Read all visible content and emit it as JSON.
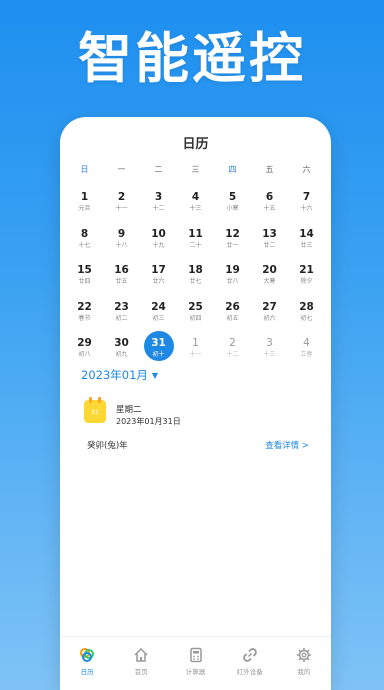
{
  "hero_title": "智能遥控",
  "screen_title": "日历",
  "weekdays": [
    "日",
    "一",
    "二",
    "三",
    "四",
    "五",
    "六"
  ],
  "days": [
    {
      "num": "1",
      "lunar": "元旦",
      "other": false
    },
    {
      "num": "2",
      "lunar": "十一",
      "other": false
    },
    {
      "num": "3",
      "lunar": "十二",
      "other": false
    },
    {
      "num": "4",
      "lunar": "十三",
      "other": false
    },
    {
      "num": "5",
      "lunar": "小寒",
      "other": false
    },
    {
      "num": "6",
      "lunar": "十五",
      "other": false
    },
    {
      "num": "7",
      "lunar": "十六",
      "other": false
    },
    {
      "num": "8",
      "lunar": "十七",
      "other": false
    },
    {
      "num": "9",
      "lunar": "十八",
      "other": false
    },
    {
      "num": "10",
      "lunar": "十九",
      "other": false
    },
    {
      "num": "11",
      "lunar": "二十",
      "other": false
    },
    {
      "num": "12",
      "lunar": "廿一",
      "other": false
    },
    {
      "num": "13",
      "lunar": "廿二",
      "other": false
    },
    {
      "num": "14",
      "lunar": "廿三",
      "other": false
    },
    {
      "num": "15",
      "lunar": "廿四",
      "other": false
    },
    {
      "num": "16",
      "lunar": "廿五",
      "other": false
    },
    {
      "num": "17",
      "lunar": "廿六",
      "other": false
    },
    {
      "num": "18",
      "lunar": "廿七",
      "other": false
    },
    {
      "num": "19",
      "lunar": "廿八",
      "other": false
    },
    {
      "num": "20",
      "lunar": "大寒",
      "other": false
    },
    {
      "num": "21",
      "lunar": "除夕",
      "other": false
    },
    {
      "num": "22",
      "lunar": "春节",
      "other": false
    },
    {
      "num": "23",
      "lunar": "初二",
      "other": false
    },
    {
      "num": "24",
      "lunar": "初三",
      "other": false
    },
    {
      "num": "25",
      "lunar": "初四",
      "other": false
    },
    {
      "num": "26",
      "lunar": "初五",
      "other": false
    },
    {
      "num": "27",
      "lunar": "初六",
      "other": false
    },
    {
      "num": "28",
      "lunar": "初七",
      "other": false
    },
    {
      "num": "29",
      "lunar": "初八",
      "other": false
    },
    {
      "num": "30",
      "lunar": "初九",
      "other": false
    },
    {
      "num": "31",
      "lunar": "初十",
      "other": false,
      "selected": true
    },
    {
      "num": "1",
      "lunar": "十一",
      "other": true
    },
    {
      "num": "2",
      "lunar": "十二",
      "other": true
    },
    {
      "num": "3",
      "lunar": "十三",
      "other": true
    },
    {
      "num": "4",
      "lunar": "立春",
      "other": true
    }
  ],
  "month_label": "2023年01月",
  "info": {
    "icon_day": "31",
    "weekday": "星期二",
    "date": "2023年01月31日",
    "year_text": "癸卯(兔)年",
    "details": "查看详情 >"
  },
  "nav": [
    {
      "label": "日历",
      "icon": "calendar-rings-icon",
      "active": true
    },
    {
      "label": "首页",
      "icon": "home-icon",
      "active": false
    },
    {
      "label": "计算器",
      "icon": "calculator-icon",
      "active": false
    },
    {
      "label": "红外设备",
      "icon": "link-icon",
      "active": false
    },
    {
      "label": "我的",
      "icon": "settings-icon",
      "active": false
    }
  ],
  "colors": {
    "accent": "#1e88e5",
    "calendar_icon": "#fdd835",
    "background_top": "#1e8ff0"
  }
}
